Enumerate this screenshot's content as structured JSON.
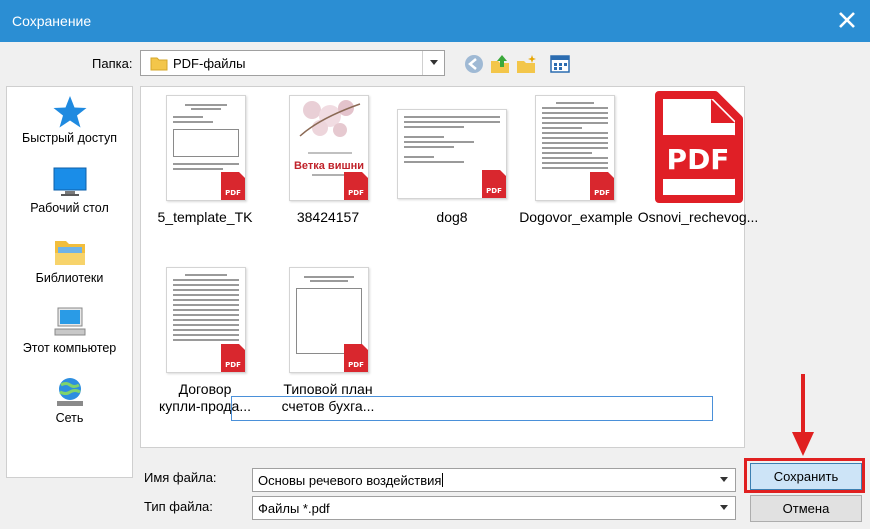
{
  "window": {
    "title": "Сохранение"
  },
  "folder": {
    "label": "Папка:",
    "underline_char": "П",
    "label_rest": "апка:",
    "current": "PDF-файлы"
  },
  "toolbar": {
    "icons": [
      "back-icon",
      "up-folder-icon",
      "new-folder-icon",
      "view-menu-icon"
    ]
  },
  "places": [
    {
      "label": "Быстрый доступ",
      "icon": "quick-access-star-icon"
    },
    {
      "label": "Рабочий стол",
      "icon": "desktop-icon"
    },
    {
      "label": "Библиотеки",
      "icon": "libraries-icon"
    },
    {
      "label": "Этот компьютер",
      "icon": "computer-icon"
    },
    {
      "label": "Сеть",
      "icon": "network-icon"
    }
  ],
  "files": [
    {
      "name": "5_template_TK"
    },
    {
      "name": "38424157",
      "thumb_title": "Ветка вишни"
    },
    {
      "name": "dog8"
    },
    {
      "name": "Dogovor_example"
    },
    {
      "name": "Osnovi_rechevog..."
    },
    {
      "name_line1": "Договор",
      "name_line2": "купли-прода..."
    },
    {
      "name_line1": "Типовой план",
      "name_line2": "счетов бухга..."
    }
  ],
  "pdf_badge": "PDF",
  "big_pdf_label": "PDF",
  "filename": {
    "label": "Имя файла:",
    "value": "Основы речевого воздействия"
  },
  "filetype": {
    "label": "Тип файла:",
    "value": "Файлы *.pdf"
  },
  "buttons": {
    "save": "Сохранить",
    "cancel": "Отмена"
  },
  "colors": {
    "titlebar": "#2b8ed3",
    "pdf_red": "#d9272e",
    "highlight": "#e02020",
    "save_button": "#cde4f7"
  }
}
